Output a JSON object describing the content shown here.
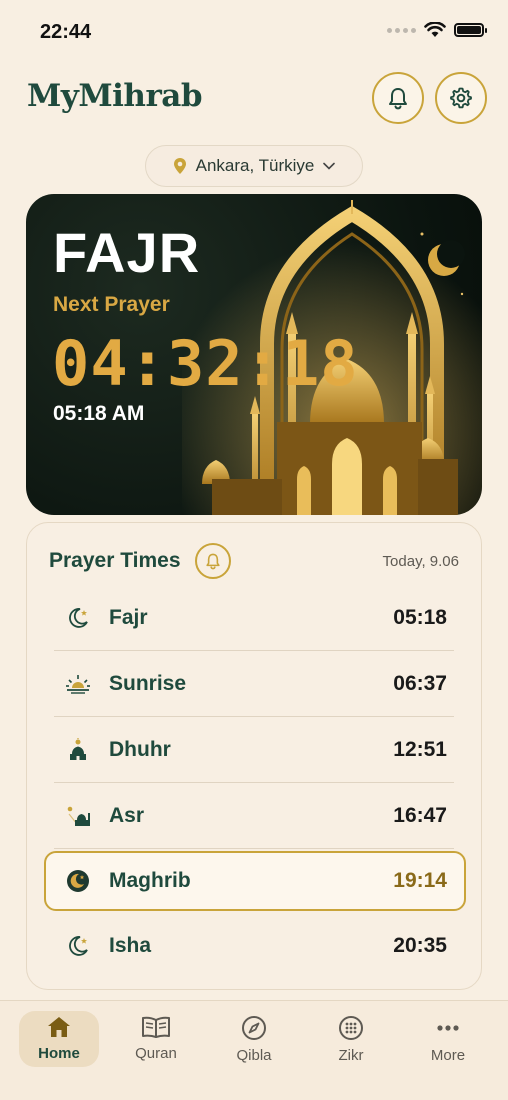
{
  "status": {
    "time": "22:44"
  },
  "app": {
    "title": "MyMihrab"
  },
  "header": {
    "bell_icon": "bell-icon",
    "settings_icon": "gear-icon"
  },
  "location": {
    "label": "Ankara, Türkiye",
    "icon": "map-pin-icon"
  },
  "hero": {
    "prayer": "FAJR",
    "next_label": "Next Prayer",
    "countdown": "04:32:18",
    "time": "05:18 AM"
  },
  "prayer_times": {
    "title": "Prayer Times",
    "date": "Today, 9.06",
    "items": [
      {
        "name": "Fajr",
        "time": "05:18",
        "icon": "crescent-star-icon"
      },
      {
        "name": "Sunrise",
        "time": "06:37",
        "icon": "sunrise-icon"
      },
      {
        "name": "Dhuhr",
        "time": "12:51",
        "icon": "mosque-sun-icon"
      },
      {
        "name": "Asr",
        "time": "16:47",
        "icon": "mosque-afternoon-icon"
      },
      {
        "name": "Maghrib",
        "time": "19:14",
        "icon": "crescent-badge-icon",
        "active": true
      },
      {
        "name": "Isha",
        "time": "20:35",
        "icon": "crescent-star-icon"
      }
    ]
  },
  "tabs": [
    {
      "label": "Home",
      "icon": "home-icon",
      "active": true
    },
    {
      "label": "Quran",
      "icon": "book-icon"
    },
    {
      "label": "Qibla",
      "icon": "compass-icon"
    },
    {
      "label": "Zikr",
      "icon": "prayer-beads-icon"
    },
    {
      "label": "More",
      "icon": "more-dots-icon"
    }
  ],
  "colors": {
    "accent": "#c9a43a",
    "primary": "#1f4a3d",
    "background": "#f8efe2",
    "countdown": "#e2aa43"
  }
}
